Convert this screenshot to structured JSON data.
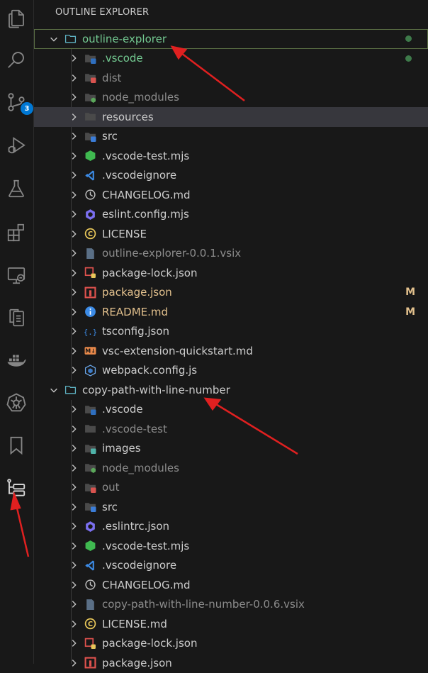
{
  "sidebar": {
    "title": "OUTLINE EXPLORER"
  },
  "activity": {
    "scm_badge": "3"
  },
  "tree": [
    {
      "label": "outline-explorer",
      "level": 0,
      "kind": "root",
      "style": "git-root",
      "dot": true
    },
    {
      "label": ".vscode",
      "level": 1,
      "kind": "folder",
      "icon": "folder-vscode-icon",
      "style": "git-root",
      "dot": true
    },
    {
      "label": "dist",
      "level": 1,
      "kind": "folder",
      "icon": "folder-dist-icon",
      "style": "ignored"
    },
    {
      "label": "node_modules",
      "level": 1,
      "kind": "folder",
      "icon": "folder-node-icon",
      "style": "ignored"
    },
    {
      "label": "resources",
      "level": 1,
      "kind": "folder",
      "icon": "folder-icon",
      "style": "normal",
      "selected": true
    },
    {
      "label": "src",
      "level": 1,
      "kind": "folder",
      "icon": "folder-src-icon",
      "style": "normal"
    },
    {
      "label": ".vscode-test.mjs",
      "level": 1,
      "kind": "file",
      "icon": "node-hexagon-icon",
      "style": "normal"
    },
    {
      "label": ".vscodeignore",
      "level": 1,
      "kind": "file",
      "icon": "vscode-logo-icon",
      "style": "normal"
    },
    {
      "label": "CHANGELOG.md",
      "level": 1,
      "kind": "file",
      "icon": "changelog-icon",
      "style": "normal"
    },
    {
      "label": "eslint.config.mjs",
      "level": 1,
      "kind": "file",
      "icon": "eslint-icon",
      "style": "normal"
    },
    {
      "label": "LICENSE",
      "level": 1,
      "kind": "file",
      "icon": "license-icon",
      "style": "normal"
    },
    {
      "label": "outline-explorer-0.0.1.vsix",
      "level": 1,
      "kind": "file",
      "icon": "vsix-file-icon",
      "style": "ignored"
    },
    {
      "label": "package-lock.json",
      "level": 1,
      "kind": "file",
      "icon": "package-lock-icon",
      "style": "normal"
    },
    {
      "label": "package.json",
      "level": 1,
      "kind": "file",
      "icon": "npm-icon",
      "style": "modified",
      "status": "M"
    },
    {
      "label": "README.md",
      "level": 1,
      "kind": "file",
      "icon": "info-icon",
      "style": "modified",
      "status": "M"
    },
    {
      "label": "tsconfig.json",
      "level": 1,
      "kind": "file",
      "icon": "tsconfig-icon",
      "style": "normal"
    },
    {
      "label": "vsc-extension-quickstart.md",
      "level": 1,
      "kind": "file",
      "icon": "markdown-icon",
      "style": "normal"
    },
    {
      "label": "webpack.config.js",
      "level": 1,
      "kind": "file",
      "icon": "webpack-icon",
      "style": "normal"
    },
    {
      "label": "copy-path-with-line-number",
      "level": 0,
      "kind": "root",
      "style": "normal"
    },
    {
      "label": ".vscode",
      "level": 1,
      "kind": "folder",
      "icon": "folder-vscode-icon",
      "style": "normal"
    },
    {
      "label": ".vscode-test",
      "level": 1,
      "kind": "folder",
      "icon": "folder-icon",
      "style": "ignored"
    },
    {
      "label": "images",
      "level": 1,
      "kind": "folder",
      "icon": "folder-images-icon",
      "style": "normal"
    },
    {
      "label": "node_modules",
      "level": 1,
      "kind": "folder",
      "icon": "folder-node-icon",
      "style": "ignored"
    },
    {
      "label": "out",
      "level": 1,
      "kind": "folder",
      "icon": "folder-dist-icon",
      "style": "ignored"
    },
    {
      "label": "src",
      "level": 1,
      "kind": "folder",
      "icon": "folder-src-icon",
      "style": "normal"
    },
    {
      "label": ".eslintrc.json",
      "level": 1,
      "kind": "file",
      "icon": "eslint-icon",
      "style": "normal"
    },
    {
      "label": ".vscode-test.mjs",
      "level": 1,
      "kind": "file",
      "icon": "node-hexagon-icon",
      "style": "normal"
    },
    {
      "label": ".vscodeignore",
      "level": 1,
      "kind": "file",
      "icon": "vscode-logo-icon",
      "style": "normal"
    },
    {
      "label": "CHANGELOG.md",
      "level": 1,
      "kind": "file",
      "icon": "changelog-icon",
      "style": "normal"
    },
    {
      "label": "copy-path-with-line-number-0.0.6.vsix",
      "level": 1,
      "kind": "file",
      "icon": "vsix-file-icon",
      "style": "ignored"
    },
    {
      "label": "LICENSE.md",
      "level": 1,
      "kind": "file",
      "icon": "license-icon",
      "style": "normal"
    },
    {
      "label": "package-lock.json",
      "level": 1,
      "kind": "file",
      "icon": "package-lock-icon",
      "style": "normal"
    },
    {
      "label": "package.json",
      "level": 1,
      "kind": "file",
      "icon": "npm-icon",
      "style": "normal"
    }
  ],
  "colors": {
    "git_added": "#73c991",
    "modified": "#e2c08d",
    "ignored": "#8c8c8c",
    "accent_badge": "#0078d4",
    "annotation_arrow": "#e02020"
  }
}
